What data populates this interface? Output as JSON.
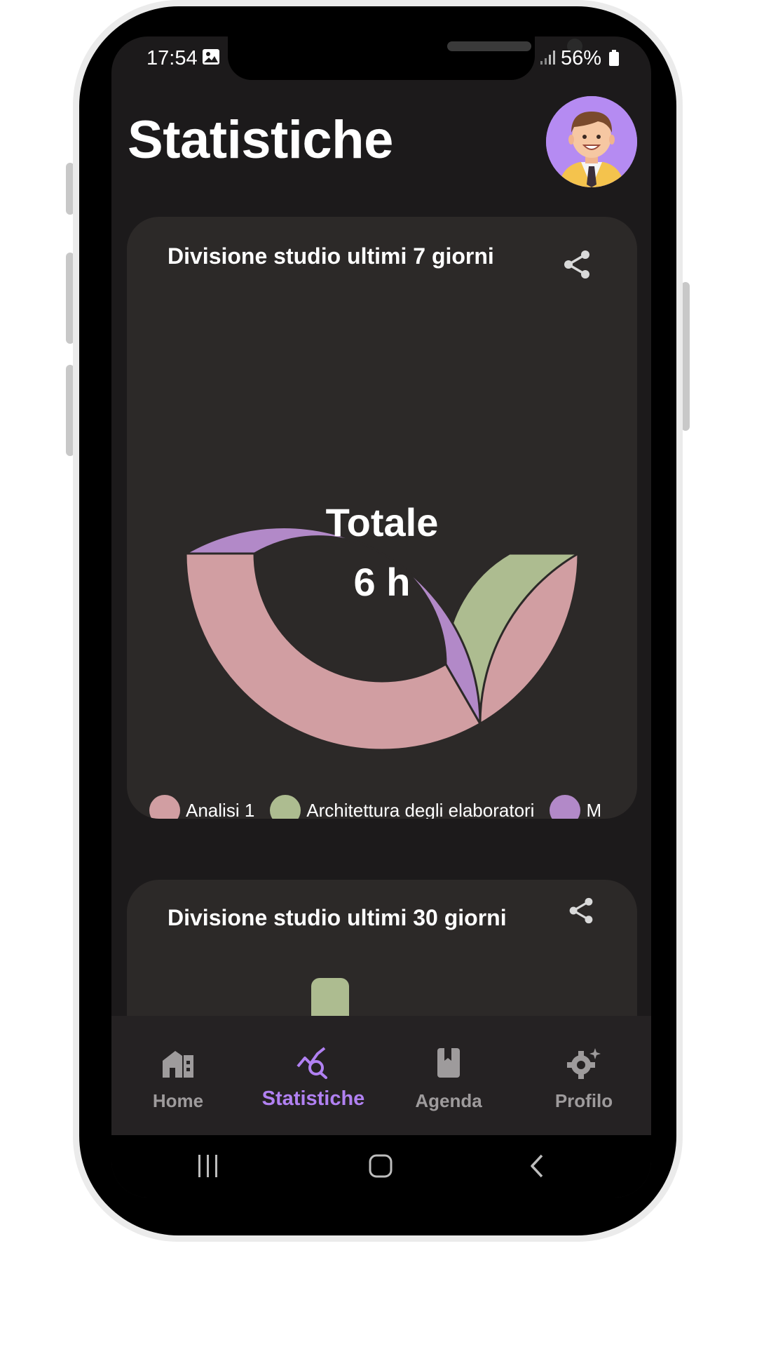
{
  "status_bar": {
    "time": "17:54",
    "battery": "56%",
    "icons": [
      "image-icon",
      "signal-icon",
      "battery-icon"
    ]
  },
  "header": {
    "title": "Statistiche",
    "avatar_icon": "user-avatar"
  },
  "card_7_days": {
    "title": "Divisione studio ultimi 7 giorni",
    "share_icon": "share-icon",
    "center_label": "Totale",
    "center_value": "6 h",
    "legend": [
      {
        "label": "Analisi 1",
        "color": "#d19ea2"
      },
      {
        "label": "Architettura degli elaboratori",
        "color": "#adbc90"
      },
      {
        "label": "M",
        "color": "#b289c8"
      }
    ]
  },
  "card_30_days": {
    "title": "Divisione studio ultimi 30 giorni",
    "share_icon": "share-icon"
  },
  "chart_data": [
    {
      "type": "pie",
      "variant": "donut",
      "categories": [
        "Analisi 1",
        "Architettura degli elaboratori",
        "M"
      ],
      "values": [
        3,
        1,
        2
      ],
      "colors": [
        "#d19ea2",
        "#adbc90",
        "#b289c8"
      ],
      "center_text": [
        "Totale",
        "6 h"
      ],
      "legend": "bottom"
    }
  ],
  "bottom_nav": {
    "items": [
      {
        "label": "Home",
        "icon": "home-icon",
        "active": false
      },
      {
        "label": "Statistiche",
        "icon": "stats-icon",
        "active": true
      },
      {
        "label": "Agenda",
        "icon": "agenda-icon",
        "active": false
      },
      {
        "label": "Profilo",
        "icon": "settings-icon",
        "active": false
      }
    ],
    "active_color": "#b181f2",
    "inactive_color": "#9e9b9c"
  },
  "system_nav": {
    "icons": [
      "recent-apps-icon",
      "home-button-icon",
      "back-icon"
    ]
  }
}
